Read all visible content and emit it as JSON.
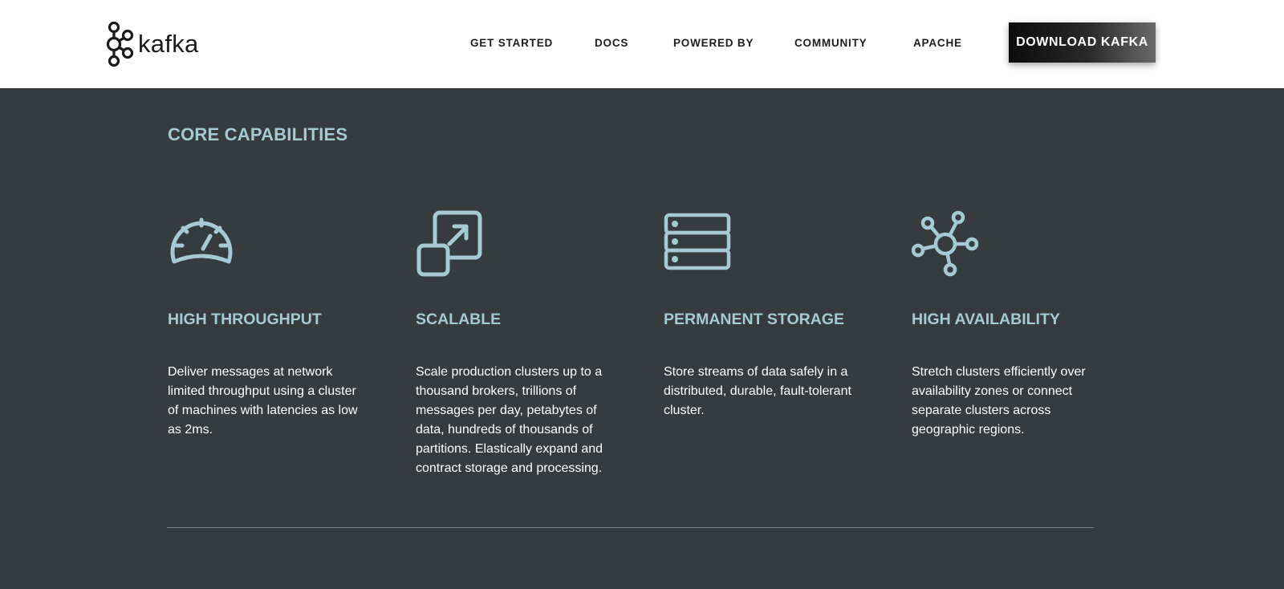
{
  "header": {
    "logo_text": "kafka",
    "logo_icon": "kafka-nodes-logo",
    "nav": [
      {
        "label": "GET STARTED"
      },
      {
        "label": "DOCS"
      },
      {
        "label": "POWERED BY"
      },
      {
        "label": "COMMUNITY"
      },
      {
        "label": "APACHE"
      }
    ],
    "download_label": "DOWNLOAD KAFKA"
  },
  "main": {
    "section_title": "CORE CAPABILITIES",
    "capabilities": [
      {
        "icon": "speedometer-icon",
        "title": "HIGH THROUGHPUT",
        "description": "Deliver messages at network limited throughput using a cluster of machines with latencies as low as 2ms."
      },
      {
        "icon": "expand-icon",
        "title": "SCALABLE",
        "description": "Scale production clusters up to a thousand brokers, trillions of messages per day, petabytes of data, hundreds of thousands of partitions. Elastically expand and contract storage and processing."
      },
      {
        "icon": "server-stack-icon",
        "title": "PERMANENT STORAGE",
        "description": "Store streams of data safely in a distributed, durable, fault-tolerant cluster."
      },
      {
        "icon": "network-hub-icon",
        "title": "HIGH AVAILABILITY",
        "description": "Stretch clusters efficiently over availability zones or connect separate clusters across geographic regions."
      }
    ]
  },
  "colors": {
    "background": "#353b3e",
    "accent": "#a5cad3",
    "header_bg": "#ffffff"
  }
}
